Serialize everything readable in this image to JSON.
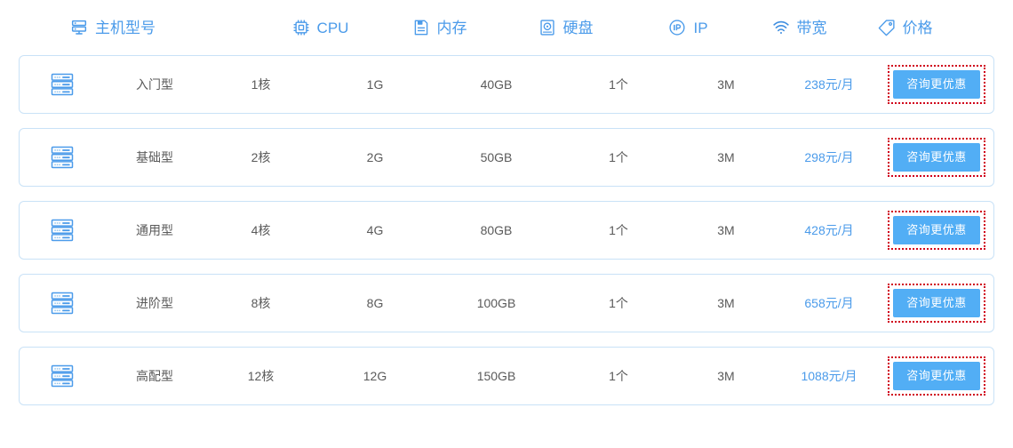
{
  "table": {
    "columns": [
      {
        "key": "model",
        "label": "主机型号",
        "icon": "server-rack-icon"
      },
      {
        "key": "cpu",
        "label": "CPU",
        "icon": "cpu-chip-icon"
      },
      {
        "key": "memory",
        "label": "内存",
        "icon": "memory-card-icon"
      },
      {
        "key": "disk",
        "label": "硬盘",
        "icon": "hard-disk-icon"
      },
      {
        "key": "ip",
        "label": "IP",
        "icon": "ip-circle-icon"
      },
      {
        "key": "bandwidth",
        "label": "带宽",
        "icon": "wifi-signal-icon"
      },
      {
        "key": "price",
        "label": "价格",
        "icon": "price-tag-icon"
      }
    ],
    "rows": [
      {
        "icon": "server-stack-icon",
        "model": "入门型",
        "cpu": "1核",
        "memory": "1G",
        "disk": "40GB",
        "ip": "1个",
        "bandwidth": "3M",
        "price": "238元/月",
        "action_label": "咨询更优惠"
      },
      {
        "icon": "server-stack-icon",
        "model": "基础型",
        "cpu": "2核",
        "memory": "2G",
        "disk": "50GB",
        "ip": "1个",
        "bandwidth": "3M",
        "price": "298元/月",
        "action_label": "咨询更优惠"
      },
      {
        "icon": "server-stack-icon",
        "model": "通用型",
        "cpu": "4核",
        "memory": "4G",
        "disk": "80GB",
        "ip": "1个",
        "bandwidth": "3M",
        "price": "428元/月",
        "action_label": "咨询更优惠"
      },
      {
        "icon": "server-stack-icon",
        "model": "进阶型",
        "cpu": "8核",
        "memory": "8G",
        "disk": "100GB",
        "ip": "1个",
        "bandwidth": "3M",
        "price": "658元/月",
        "action_label": "咨询更优惠"
      },
      {
        "icon": "server-stack-icon",
        "model": "高配型",
        "cpu": "12核",
        "memory": "12G",
        "disk": "150GB",
        "ip": "1个",
        "bandwidth": "3M",
        "price": "1088元/月",
        "action_label": "咨询更优惠"
      }
    ]
  },
  "colors": {
    "accent_blue": "#4b9bea",
    "button_blue": "#52aef5",
    "card_border": "#c9e2f7",
    "value_gray": "#5a5a5a",
    "highlight_red": "#d0021b"
  }
}
